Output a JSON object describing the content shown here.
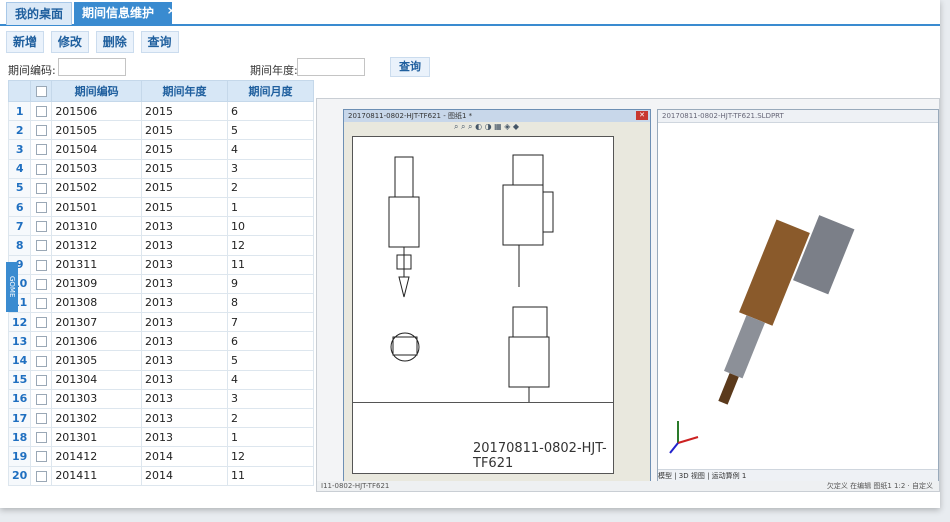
{
  "tabs": {
    "desk": "我的桌面",
    "active": "期间信息维护",
    "close": "×"
  },
  "toolbar": {
    "add": "新增",
    "edit": "修改",
    "delete": "删除",
    "query": "查询"
  },
  "filters": {
    "code_label": "期间编码:",
    "year_label": "期间年度:",
    "query_button": "查询"
  },
  "table": {
    "headers": [
      "期间编码",
      "期间年度",
      "期间月度"
    ],
    "rows": [
      {
        "n": "1",
        "code": "201506",
        "year": "2015",
        "month": "6"
      },
      {
        "n": "2",
        "code": "201505",
        "year": "2015",
        "month": "5"
      },
      {
        "n": "3",
        "code": "201504",
        "year": "2015",
        "month": "4"
      },
      {
        "n": "4",
        "code": "201503",
        "year": "2015",
        "month": "3"
      },
      {
        "n": "5",
        "code": "201502",
        "year": "2015",
        "month": "2"
      },
      {
        "n": "6",
        "code": "201501",
        "year": "2015",
        "month": "1"
      },
      {
        "n": "7",
        "code": "201310",
        "year": "2013",
        "month": "10"
      },
      {
        "n": "8",
        "code": "201312",
        "year": "2013",
        "month": "12"
      },
      {
        "n": "9",
        "code": "201311",
        "year": "2013",
        "month": "11"
      },
      {
        "n": "10",
        "code": "201309",
        "year": "2013",
        "month": "9"
      },
      {
        "n": "11",
        "code": "201308",
        "year": "2013",
        "month": "8"
      },
      {
        "n": "12",
        "code": "201307",
        "year": "2013",
        "month": "7"
      },
      {
        "n": "13",
        "code": "201306",
        "year": "2013",
        "month": "6"
      },
      {
        "n": "14",
        "code": "201305",
        "year": "2013",
        "month": "5"
      },
      {
        "n": "15",
        "code": "201304",
        "year": "2013",
        "month": "4"
      },
      {
        "n": "16",
        "code": "201303",
        "year": "2013",
        "month": "3"
      },
      {
        "n": "17",
        "code": "201302",
        "year": "2013",
        "month": "2"
      },
      {
        "n": "18",
        "code": "201301",
        "year": "2013",
        "month": "1"
      },
      {
        "n": "19",
        "code": "201412",
        "year": "2014",
        "month": "12"
      },
      {
        "n": "20",
        "code": "201411",
        "year": "2014",
        "month": "11"
      }
    ]
  },
  "side_tab": "GOME",
  "screenshot": {
    "win1_title": "20170811-0802-HJT-TF621 - 图纸1 *",
    "drawing_caption": "20170811-0802-HJT-TF621",
    "win2_title": "20170811-0802-HJT-TF621.SLDPRT",
    "bottom_tabs": "模型 | 3D 视图 | 运动算例 1",
    "status_left": "I11-0802-HJT-TF621",
    "status_right": "欠定义   在编辑 图纸1    1:2   ·   自定义"
  }
}
